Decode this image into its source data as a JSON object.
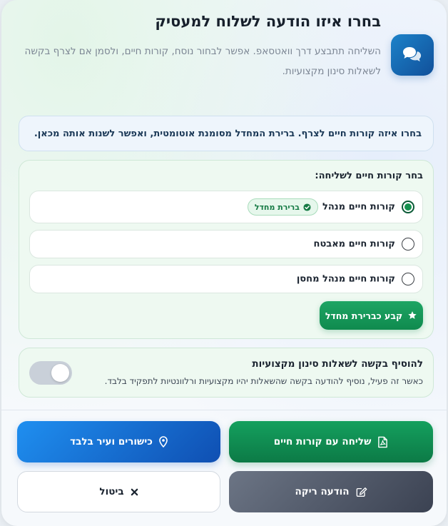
{
  "dialog": {
    "title": "בחרו איזו הודעה לשלוח למעסיק",
    "subtitle": "השליחה תתבצע דרך וואטסאפ. אפשר לבחור נוסח, קורות חיים, ולסמן אם לצרף בקשה לשאלות סינון מקצועיות.",
    "header_icon": "chat-bubbles-icon",
    "info_text": "בחרו איזה קורות חיים לצרף. ברירת המחדל מסומנת אוטומטית, ואפשר לשנות אותה מכאן."
  },
  "cv_section": {
    "heading": "בחר קורות חיים לשליחה:",
    "options": [
      {
        "label": "קורות חיים מנהל",
        "selected": true,
        "badge": "ברירת מחדל"
      },
      {
        "label": "קורות חיים מאבטח",
        "selected": false
      },
      {
        "label": "קורות חיים מנהל מחסן",
        "selected": false
      }
    ],
    "set_default_label": "קבע כברירת מחדל"
  },
  "screening": {
    "title": "להוסיף בקשה לשאלות סינון מקצועיות",
    "description": "כאשר זה פעיל, נוסיף להודעה בקשה שהשאלות יהיו מקצועיות ורלוונטיות לתפקיד בלבד.",
    "enabled": false
  },
  "actions": {
    "send_cv": "שליחה עם קורות חיים",
    "skills_only": "כישורים ועיר בלבד",
    "empty_message": "הודעה ריקה",
    "cancel": "ביטול"
  },
  "colors": {
    "primary_green": "#0f8a4e",
    "primary_blue": "#0f4fb2",
    "slate": "#3b4252"
  }
}
